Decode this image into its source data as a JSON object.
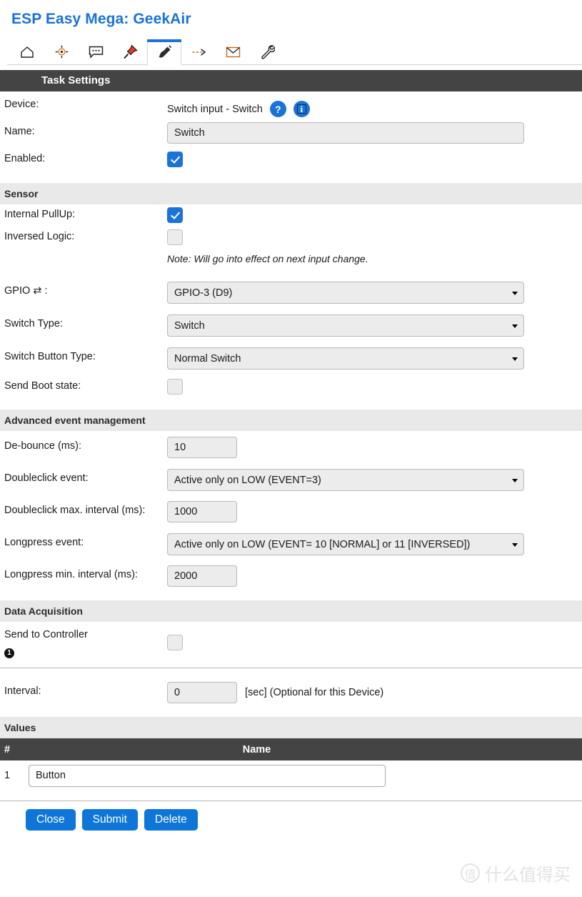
{
  "header": {
    "title": "ESP Easy Mega: GeekAir"
  },
  "nav": {
    "tabs": [
      {
        "icon": "home-icon",
        "name": "nav-tab-main",
        "active": false
      },
      {
        "icon": "gear-icon",
        "name": "nav-tab-config",
        "active": false
      },
      {
        "icon": "chat-icon",
        "name": "nav-tab-controllers",
        "active": false
      },
      {
        "icon": "pin-icon",
        "name": "nav-tab-hardware",
        "active": false
      },
      {
        "icon": "plug-icon",
        "name": "nav-tab-devices",
        "active": true
      },
      {
        "icon": "arrow-right-icon",
        "name": "nav-tab-rules",
        "active": false
      },
      {
        "icon": "envelope-icon",
        "name": "nav-tab-notifications",
        "active": false
      },
      {
        "icon": "wrench-icon",
        "name": "nav-tab-tools",
        "active": false
      }
    ]
  },
  "sections": {
    "task_settings": "Task Settings",
    "sensor": "Sensor",
    "advanced": "Advanced event management",
    "data_acquisition": "Data Acquisition",
    "values": "Values"
  },
  "task": {
    "device_label": "Device:",
    "device_value": "Switch input - Switch",
    "help_icon": "?",
    "info_icon": "i",
    "name_label": "Name:",
    "name_value": "Switch",
    "name_placeholder": "",
    "enabled_label": "Enabled:",
    "enabled_checked": true
  },
  "sensor": {
    "pullup_label": "Internal PullUp:",
    "pullup_checked": true,
    "inversed_label": "Inversed Logic:",
    "inversed_checked": false,
    "note": "Note: Will go into effect on next input change.",
    "gpio_label": "GPIO ⇄ :",
    "gpio_value": "GPIO-3 (D9)",
    "switch_type_label": "Switch Type:",
    "switch_type_value": "Switch",
    "switch_button_type_label": "Switch Button Type:",
    "switch_button_type_value": "Normal Switch",
    "send_boot_label": "Send Boot state:",
    "send_boot_checked": false
  },
  "advanced": {
    "debounce_label": "De-bounce (ms):",
    "debounce_value": "10",
    "doubleclick_event_label": "Doubleclick event:",
    "doubleclick_event_value": "Active only on LOW (EVENT=3)",
    "doubleclick_interval_label": "Doubleclick max. interval (ms):",
    "doubleclick_interval_value": "1000",
    "longpress_event_label": "Longpress event:",
    "longpress_event_value": "Active only on LOW (EVENT= 10 [NORMAL] or 11 [INVERSED])",
    "longpress_interval_label": "Longpress min. interval (ms):",
    "longpress_interval_value": "2000"
  },
  "data_acquisition": {
    "send_to_controller_label": "Send to Controller",
    "controller_index": "1",
    "send_to_controller_checked": false,
    "interval_label": "Interval:",
    "interval_value": "0",
    "interval_suffix": "[sec] (Optional for this Device)"
  },
  "values_table": {
    "columns": [
      "#",
      "Name"
    ],
    "rows": [
      {
        "num": "1",
        "name": "Button"
      }
    ]
  },
  "footer": {
    "close_label": "Close",
    "submit_label": "Submit",
    "delete_label": "Delete"
  },
  "watermark": {
    "mark": "值",
    "text": "什么值得买"
  },
  "colors": {
    "accent": "#1a73d6",
    "button": "#0d76d8",
    "dark_bar": "#444444",
    "light_bar": "#e9e9e9"
  }
}
